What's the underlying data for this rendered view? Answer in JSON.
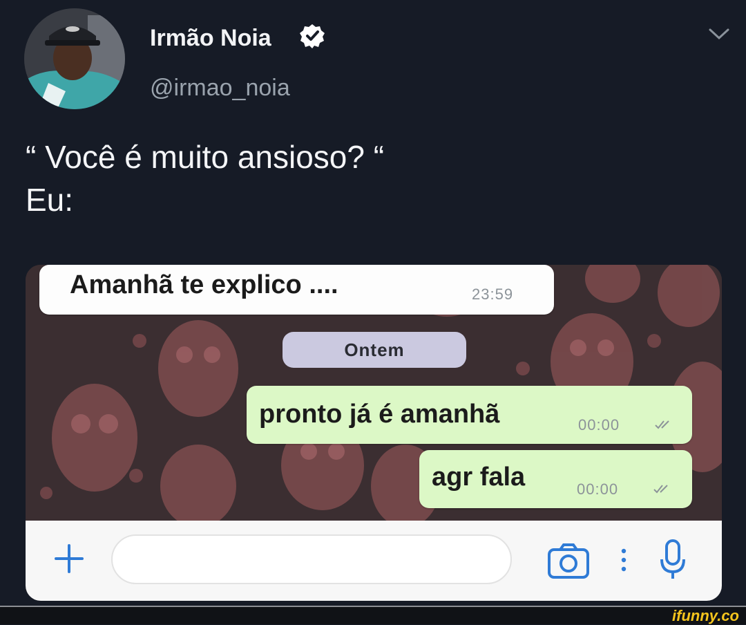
{
  "tweet": {
    "author_name": "Irmão Noia",
    "handle": "@irmao_noia",
    "verified": true,
    "text_line1": "“ Você é muito ansioso? “",
    "text_line2": "Eu:"
  },
  "chat": {
    "messages": [
      {
        "direction": "incoming",
        "text": "Amanhã te explico ....",
        "time": "23:59"
      },
      {
        "direction": "outgoing",
        "text": "pronto já é amanhã",
        "time": "00:00",
        "status": "double-check-icon"
      },
      {
        "direction": "outgoing",
        "text": "agr fala",
        "time": "00:00",
        "status": "double-check-icon"
      }
    ],
    "date_separator": "Ontem",
    "input_placeholder": "",
    "icons": [
      "plus-icon",
      "camera-icon",
      "more-dots-icon",
      "microphone-icon"
    ]
  },
  "watermark": "ifunny.co",
  "colors": {
    "tweet_background": "#161b26",
    "incoming_bubble": "#fdfdfd",
    "outgoing_bubble": "#dcf8c6",
    "accent_blue": "#2f7bd6",
    "watermark": "#f6c51d"
  }
}
